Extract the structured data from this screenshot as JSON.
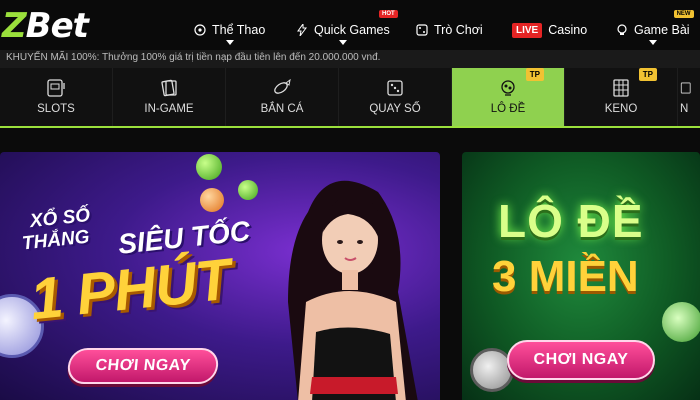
{
  "brand": {
    "logo_z": "Z",
    "logo_rest": "Bet"
  },
  "nav": [
    {
      "label": "Thể Thao",
      "icon": "soccer-ball-icon",
      "caret": true
    },
    {
      "label": "Quick Games",
      "icon": "lightning-icon",
      "caret": true,
      "badge": "HOT"
    },
    {
      "label": "Trò Chơi",
      "icon": "dice-icon",
      "caret": false
    },
    {
      "label": "Casino",
      "icon": "live-badge",
      "caret": false,
      "badge": "LIVE"
    },
    {
      "label": "Game Bài",
      "icon": "bulb-icon",
      "caret": true,
      "badge": "NEW"
    }
  ],
  "ticker": {
    "text": "KHUYẾN MÃI 100%: Thưởng 100% giá trị tiền nạp đầu tiên lên đến 20.000.000 vnđ."
  },
  "categories": [
    {
      "label": "SLOTS",
      "icon": "slot-machine-icon",
      "active": false
    },
    {
      "label": "IN-GAME",
      "icon": "cards-icon",
      "active": false
    },
    {
      "label": "BẮN CÁ",
      "icon": "fish-icon",
      "active": false
    },
    {
      "label": "QUAY SỐ",
      "icon": "dice-icon",
      "active": false
    },
    {
      "label": "LÔ ĐỀ",
      "icon": "lottery-icon",
      "active": true,
      "badge": "TP"
    },
    {
      "label": "KENO",
      "icon": "keno-grid-icon",
      "active": false,
      "badge": "TP"
    },
    {
      "label": "N",
      "icon": "grid-icon",
      "active": false
    }
  ],
  "banners": [
    {
      "line1": "XỔ SỐ",
      "line2": "THẮNG",
      "line3": "SIÊU TỐC",
      "line4": "1 PHÚT",
      "cta": "CHƠI NGAY"
    },
    {
      "line1": "LÔ ĐỀ",
      "line2": "3 MIỀN",
      "cta": "CHƠI NGAY"
    }
  ],
  "colors": {
    "accent": "#9be03c",
    "active_tab": "#8fd14f",
    "hot": "#e52424",
    "badge_gold": "#f1c232"
  }
}
